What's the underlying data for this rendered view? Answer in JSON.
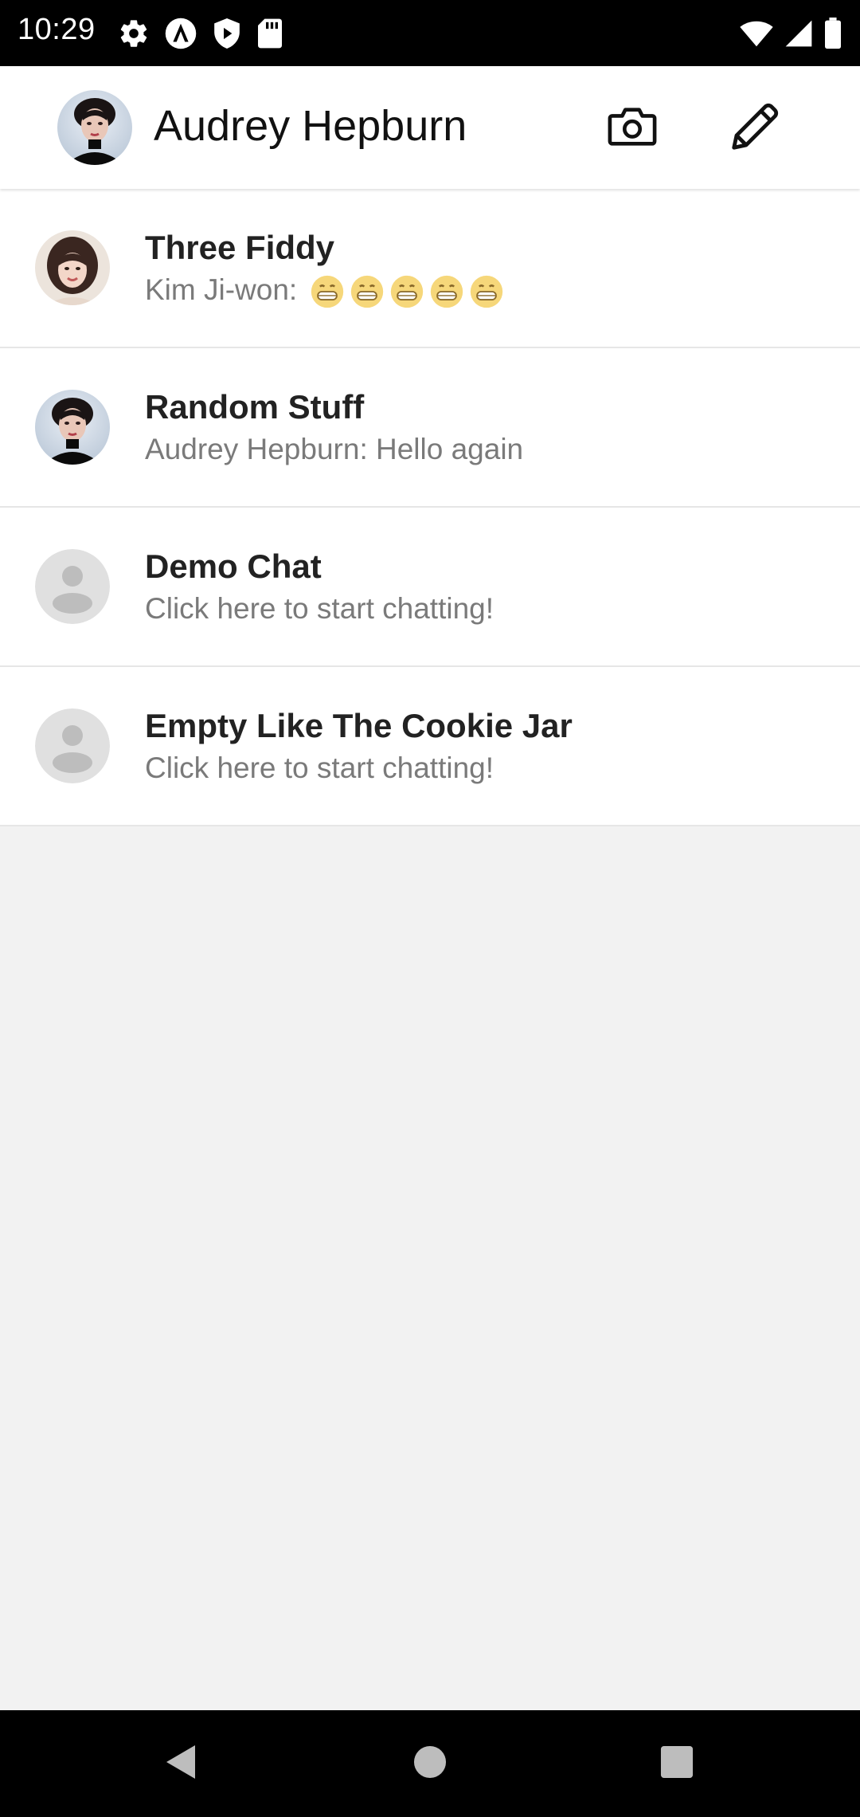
{
  "status_bar": {
    "time": "10:29",
    "left_icons": [
      "gear-icon",
      "a-badge-icon",
      "shield-play-icon",
      "sd-card-icon"
    ],
    "right_icons": [
      "wifi-icon",
      "signal-icon",
      "battery-icon"
    ]
  },
  "header": {
    "title": "Audrey Hepburn",
    "actions": [
      "camera-icon",
      "pencil-icon"
    ]
  },
  "chats": [
    {
      "name": "Three Fiddy",
      "preview": "Kim Ji-won:",
      "emojis": [
        "😁",
        "😁",
        "😁",
        "😁",
        "😁"
      ],
      "avatar": "photo"
    },
    {
      "name": "Random Stuff",
      "preview": "Audrey Hepburn: Hello again",
      "avatar": "photo"
    },
    {
      "name": "Demo Chat",
      "preview": "Click here to start chatting!",
      "avatar": "placeholder"
    },
    {
      "name": "Empty Like The Cookie Jar",
      "preview": "Click here to start chatting!",
      "avatar": "placeholder"
    }
  ],
  "nav_bar": {
    "buttons": [
      "back-icon",
      "home-icon",
      "recents-icon"
    ]
  },
  "colors": {
    "status_bar": "#000000",
    "header_bg": "#ffffff",
    "list_bg": "#ffffff",
    "page_bg": "#f2f2f2",
    "name_text": "#222222",
    "preview_text": "#7a7a7a",
    "placeholder_avatar": "#e0e0e0"
  }
}
